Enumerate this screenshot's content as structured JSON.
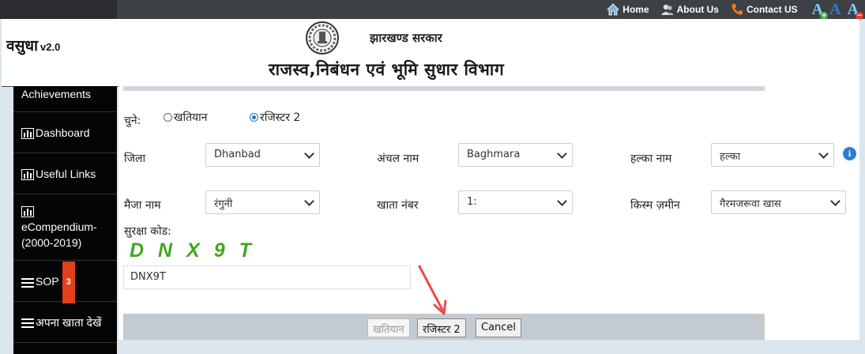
{
  "topnav": {
    "home": "Home",
    "about": "About Us",
    "contact": "Contact US",
    "font_increase": "A",
    "font_normal": "A",
    "font_decrease": "A"
  },
  "header": {
    "brand": "वसुधा",
    "version": "v2.0",
    "government": "झारखण्ड सरकार",
    "department": "राजस्व,निबंधन एवं भूमि सुधार विभाग"
  },
  "sidebar": {
    "items": [
      {
        "label": "Achievements"
      },
      {
        "label": "Dashboard"
      },
      {
        "label": "Useful Links"
      },
      {
        "label": "eCompendium-(2000-2019)"
      },
      {
        "label": "SOP",
        "badge": "3"
      },
      {
        "label": "अपना खाता देखें"
      }
    ]
  },
  "form": {
    "choose_label": "चुने:",
    "radio_khatiyan": "खतियान",
    "radio_register2": "रजिस्टर 2",
    "district_label": "जिला",
    "district_value": "Dhanbad",
    "circle_label": "अंचल नाम",
    "circle_value": "Baghmara",
    "halka_label": "हल्का नाम",
    "halka_value": "हल्का",
    "mauza_label": "मैजा नाम",
    "mauza_value": "रंगुनी",
    "khata_label": "खाता नंबर",
    "khata_value": "1:",
    "land_type_label": "किस्म ज़मीन",
    "land_type_value": "गैरमजरूवा खास",
    "security_code_label": "सुरक्षा कोड:",
    "captcha": "DNX9T",
    "security_code_value": "DNX9T"
  },
  "buttons": {
    "khatiyan": "खतियान",
    "register2": "रजिस्टर 2",
    "cancel": "Cancel"
  },
  "colors": {
    "topbar": "#3d4146",
    "sidebar": "#050505",
    "captcha": "#43a521",
    "badge": "#e2401c",
    "arrow": "#e84b4b"
  }
}
